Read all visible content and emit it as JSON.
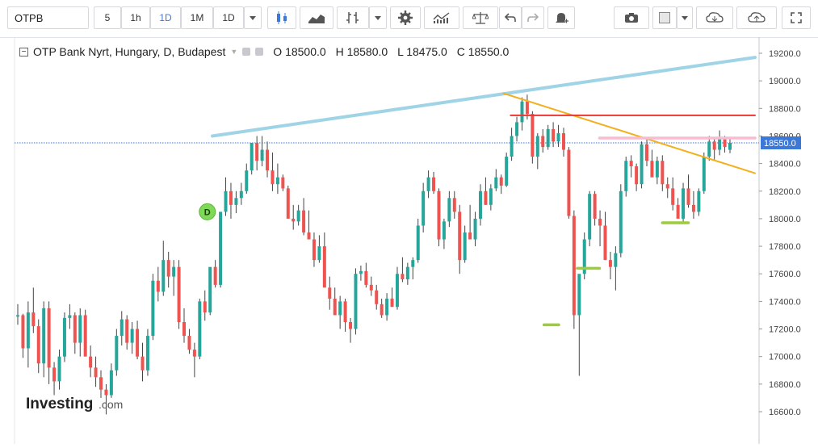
{
  "toolbar": {
    "symbol": "OTPB",
    "intervals": [
      "5",
      "1h",
      "1D",
      "1M",
      "1D"
    ],
    "active_interval": "1D"
  },
  "legend": {
    "title": "OTP Bank Nyrt, Hungary, D, Budapest",
    "open": "O 18500.0",
    "high": "H 18580.0",
    "low": "L 18475.0",
    "close": "C 18550.0"
  },
  "price_label": "18550.0",
  "brand": {
    "name": "Investing",
    "suffix": ".com"
  },
  "colors": {
    "up": "#26a69a",
    "down": "#ef5350",
    "trend_top": "#9fd3e6",
    "trend_down": "#f2b01e",
    "resistance": "#e53935",
    "level_pink": "#f8bbd0",
    "support": "#9ccc3a",
    "last_price_bg": "#3c78d8"
  },
  "chart_data": {
    "type": "candlestick",
    "yticks": [
      "19200.0",
      "19000.0",
      "18800.0",
      "18600.0",
      "18400.0",
      "18200.0",
      "18000.0",
      "17800.0",
      "17600.0",
      "17400.0",
      "17200.0",
      "17000.0",
      "16800.0",
      "16600.0"
    ],
    "ylim": [
      16600,
      19200
    ],
    "last_close": 18550.0,
    "candles": [
      [
        17290,
        17380,
        17230,
        17300
      ],
      [
        17300,
        17310,
        16990,
        17060
      ],
      [
        17060,
        17400,
        16920,
        17320
      ],
      [
        17320,
        17500,
        17170,
        17220
      ],
      [
        17220,
        17270,
        16880,
        16950
      ],
      [
        16950,
        17400,
        16850,
        17350
      ],
      [
        17350,
        17400,
        16800,
        16920
      ],
      [
        16920,
        16960,
        16720,
        16820
      ],
      [
        16820,
        17050,
        16760,
        17000
      ],
      [
        17000,
        17320,
        16960,
        17280
      ],
      [
        17280,
        17380,
        17200,
        17300
      ],
      [
        17300,
        17320,
        17020,
        17100
      ],
      [
        17100,
        17350,
        17000,
        17300
      ],
      [
        17300,
        17340,
        17080,
        17000
      ],
      [
        17000,
        17080,
        16850,
        16920
      ],
      [
        16920,
        17000,
        16780,
        16850
      ],
      [
        16850,
        16900,
        16700,
        16760
      ],
      [
        16760,
        16800,
        16580,
        16720
      ],
      [
        16720,
        16950,
        16700,
        16900
      ],
      [
        16900,
        17200,
        16860,
        17150
      ],
      [
        17150,
        17330,
        17080,
        17270
      ],
      [
        17270,
        17300,
        17050,
        17100
      ],
      [
        17100,
        17250,
        17020,
        17200
      ],
      [
        17200,
        17260,
        16980,
        17000
      ],
      [
        17000,
        17100,
        16820,
        16900
      ],
      [
        16900,
        17200,
        16860,
        17150
      ],
      [
        17150,
        17600,
        17120,
        17550
      ],
      [
        17550,
        17650,
        17400,
        17470
      ],
      [
        17470,
        17840,
        17440,
        17700
      ],
      [
        17700,
        17760,
        17500,
        17580
      ],
      [
        17580,
        17700,
        17440,
        17650
      ],
      [
        17650,
        17700,
        17200,
        17250
      ],
      [
        17250,
        17350,
        17100,
        17150
      ],
      [
        17150,
        17200,
        17020,
        17050
      ],
      [
        17050,
        17100,
        16850,
        17000
      ],
      [
        17000,
        17420,
        16980,
        17400
      ],
      [
        17400,
        17480,
        17260,
        17320
      ],
      [
        17320,
        17450,
        17300,
        17650
      ],
      [
        17650,
        17700,
        17500,
        17520
      ],
      [
        17520,
        17900,
        17500,
        18050
      ],
      [
        18050,
        18300,
        18020,
        18200
      ],
      [
        18200,
        18260,
        18000,
        18100
      ],
      [
        18100,
        18200,
        18040,
        18150
      ],
      [
        18150,
        18260,
        18100,
        18200
      ],
      [
        18200,
        18400,
        18180,
        18350
      ],
      [
        18350,
        18500,
        18320,
        18550
      ],
      [
        18550,
        18600,
        18350,
        18420
      ],
      [
        18420,
        18600,
        18380,
        18500
      ],
      [
        18500,
        18560,
        18300,
        18350
      ],
      [
        18350,
        18480,
        18200,
        18250
      ],
      [
        18250,
        18400,
        18180,
        18300
      ],
      [
        18300,
        18320,
        18200,
        18220
      ],
      [
        18220,
        18240,
        18080,
        18000
      ],
      [
        18000,
        18100,
        17920,
        17980
      ],
      [
        17980,
        18100,
        17950,
        18060
      ],
      [
        18060,
        18150,
        17880,
        17900
      ],
      [
        17900,
        18060,
        17850,
        17850
      ],
      [
        17850,
        17900,
        17650,
        17700
      ],
      [
        17700,
        17880,
        17680,
        17800
      ],
      [
        17800,
        17900,
        17650,
        17500
      ],
      [
        17500,
        17580,
        17340,
        17420
      ],
      [
        17420,
        17500,
        17360,
        17300
      ],
      [
        17300,
        17440,
        17200,
        17400
      ],
      [
        17400,
        17420,
        17180,
        17250
      ],
      [
        17250,
        17280,
        17100,
        17200
      ],
      [
        17200,
        17640,
        17160,
        17600
      ],
      [
        17600,
        17660,
        17550,
        17620
      ],
      [
        17620,
        17680,
        17500,
        17520
      ],
      [
        17520,
        17580,
        17440,
        17480
      ],
      [
        17480,
        17520,
        17340,
        17380
      ],
      [
        17380,
        17420,
        17280,
        17300
      ],
      [
        17300,
        17460,
        17260,
        17420
      ],
      [
        17420,
        17500,
        17360,
        17360
      ],
      [
        17360,
        17650,
        17340,
        17600
      ],
      [
        17600,
        17720,
        17540,
        17560
      ],
      [
        17560,
        17680,
        17520,
        17650
      ],
      [
        17650,
        17720,
        17560,
        17700
      ],
      [
        17700,
        18000,
        17680,
        17950
      ],
      [
        17950,
        18260,
        17900,
        18200
      ],
      [
        18200,
        18350,
        18150,
        18300
      ],
      [
        18300,
        18340,
        18180,
        18200
      ],
      [
        18200,
        18220,
        17800,
        17850
      ],
      [
        17850,
        18000,
        17780,
        17980
      ],
      [
        17980,
        18200,
        17940,
        18150
      ],
      [
        18150,
        18200,
        18000,
        18050
      ],
      [
        18050,
        18100,
        17600,
        17700
      ],
      [
        17700,
        17950,
        17680,
        17900
      ],
      [
        17900,
        18100,
        17850,
        17850
      ],
      [
        17850,
        18050,
        17800,
        18000
      ],
      [
        18000,
        18250,
        17950,
        18200
      ],
      [
        18200,
        18300,
        18100,
        18100
      ],
      [
        18100,
        18250,
        18060,
        18220
      ],
      [
        18220,
        18360,
        18200,
        18300
      ],
      [
        18300,
        18320,
        18180,
        18240
      ],
      [
        18240,
        18480,
        18230,
        18450
      ],
      [
        18450,
        18660,
        18420,
        18600
      ],
      [
        18600,
        18740,
        18560,
        18700
      ],
      [
        18700,
        18880,
        18640,
        18850
      ],
      [
        18850,
        18900,
        18720,
        18760
      ],
      [
        18760,
        18780,
        18400,
        18450
      ],
      [
        18450,
        18620,
        18360,
        18600
      ],
      [
        18600,
        18650,
        18480,
        18520
      ],
      [
        18520,
        18680,
        18500,
        18650
      ],
      [
        18650,
        18700,
        18520,
        18560
      ],
      [
        18560,
        18680,
        18520,
        18620
      ],
      [
        18620,
        18660,
        18450,
        18500
      ],
      [
        18500,
        18520,
        18000,
        18020
      ],
      [
        18020,
        18060,
        17200,
        17300
      ],
      [
        17300,
        17560,
        16860,
        17600
      ],
      [
        17600,
        17900,
        17560,
        17850
      ],
      [
        17850,
        18200,
        17800,
        18180
      ],
      [
        18180,
        18200,
        17950,
        18000
      ],
      [
        18000,
        18060,
        17800,
        17950
      ],
      [
        17950,
        18050,
        17700,
        17700
      ],
      [
        17700,
        17760,
        17560,
        17650
      ],
      [
        17650,
        17800,
        17480,
        17750
      ],
      [
        17750,
        18250,
        17720,
        18200
      ],
      [
        18200,
        18450,
        18160,
        18420
      ],
      [
        18420,
        18460,
        18300,
        18380
      ],
      [
        18380,
        18400,
        18200,
        18250
      ],
      [
        18250,
        18560,
        18220,
        18540
      ],
      [
        18540,
        18580,
        18380,
        18420
      ],
      [
        18420,
        18500,
        18350,
        18300
      ],
      [
        18300,
        18450,
        18250,
        18420
      ],
      [
        18420,
        18460,
        18200,
        18250
      ],
      [
        18250,
        18300,
        18150,
        18220
      ],
      [
        18220,
        18300,
        18060,
        18100
      ],
      [
        18100,
        18150,
        18040,
        18000
      ],
      [
        18000,
        18260,
        17980,
        18220
      ],
      [
        18220,
        18320,
        18080,
        18100
      ],
      [
        18100,
        18200,
        18000,
        18050
      ],
      [
        18050,
        18220,
        18020,
        18200
      ],
      [
        18200,
        18480,
        18180,
        18450
      ],
      [
        18450,
        18600,
        18420,
        18560
      ],
      [
        18560,
        18580,
        18420,
        18500
      ],
      [
        18500,
        18640,
        18460,
        18580
      ],
      [
        18580,
        18600,
        18480,
        18520
      ],
      [
        18500,
        18580,
        18475,
        18550
      ]
    ],
    "drawings": [
      {
        "kind": "trendline",
        "color": "trend_top",
        "from": [
          0.0,
          18600
        ],
        "to": [
          1.0,
          19170
        ]
      },
      {
        "kind": "trendline",
        "color": "trend_down",
        "from": [
          0.66,
          18910
        ],
        "to": [
          1.0,
          18330
        ]
      },
      {
        "kind": "hline",
        "color": "resistance",
        "price": 18750,
        "from": 0.67,
        "to": 1.0
      },
      {
        "kind": "hline",
        "color": "level_pink",
        "price": 18585,
        "from": 0.79,
        "to": 1.0
      },
      {
        "kind": "hline",
        "color": "support",
        "price": 17230,
        "from": 0.715,
        "to": 0.735
      },
      {
        "kind": "hline",
        "color": "support",
        "price": 17640,
        "from": 0.76,
        "to": 0.79
      },
      {
        "kind": "hline",
        "color": "support",
        "price": 17970,
        "from": 0.875,
        "to": 0.91
      }
    ],
    "dividend_marker": {
      "label": "D",
      "index": 36,
      "price": 18050
    }
  }
}
